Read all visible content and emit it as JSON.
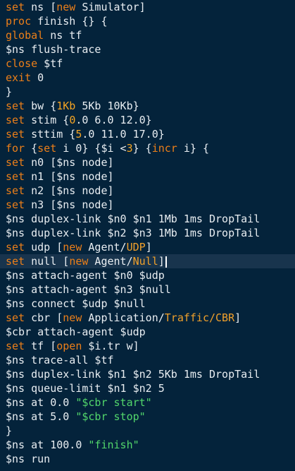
{
  "editor": {
    "lines": [
      [
        {
          "t": "set",
          "c": "kw"
        },
        {
          "t": " ns [",
          "c": "plain"
        },
        {
          "t": "new",
          "c": "kw"
        },
        {
          "t": " Simulator]",
          "c": "plain"
        }
      ],
      [
        {
          "t": "proc",
          "c": "kw"
        },
        {
          "t": " finish {} {",
          "c": "plain"
        }
      ],
      [
        {
          "t": "global",
          "c": "kw"
        },
        {
          "t": " ns tf",
          "c": "plain"
        }
      ],
      [
        {
          "t": "$ns flush-trace",
          "c": "plain"
        }
      ],
      [
        {
          "t": "close",
          "c": "kw"
        },
        {
          "t": " $tf",
          "c": "plain"
        }
      ],
      [
        {
          "t": "exit",
          "c": "kw"
        },
        {
          "t": " 0",
          "c": "plain"
        }
      ],
      [
        {
          "t": "}",
          "c": "plain"
        }
      ],
      [
        {
          "t": "set",
          "c": "kw"
        },
        {
          "t": " bw {",
          "c": "plain"
        },
        {
          "t": "1Kb",
          "c": "num"
        },
        {
          "t": " 5Kb 10Kb}",
          "c": "plain"
        }
      ],
      [
        {
          "t": "set",
          "c": "kw"
        },
        {
          "t": " stim {",
          "c": "plain"
        },
        {
          "t": "0",
          "c": "num"
        },
        {
          "t": ".0 6.0 12.0}",
          "c": "plain"
        }
      ],
      [
        {
          "t": "set",
          "c": "kw"
        },
        {
          "t": " sttim {",
          "c": "plain"
        },
        {
          "t": "5",
          "c": "num"
        },
        {
          "t": ".0 11.0 17.0}",
          "c": "plain"
        }
      ],
      [
        {
          "t": "for",
          "c": "kw"
        },
        {
          "t": " {",
          "c": "plain"
        },
        {
          "t": "set",
          "c": "kw"
        },
        {
          "t": " i 0} {$i <",
          "c": "plain"
        },
        {
          "t": "3",
          "c": "num"
        },
        {
          "t": "} {",
          "c": "plain"
        },
        {
          "t": "incr",
          "c": "kw"
        },
        {
          "t": " i} {",
          "c": "plain"
        }
      ],
      [
        {
          "t": "set",
          "c": "kw"
        },
        {
          "t": " n0 [$ns node]",
          "c": "plain"
        }
      ],
      [
        {
          "t": "set",
          "c": "kw"
        },
        {
          "t": " n1 [$ns node]",
          "c": "plain"
        }
      ],
      [
        {
          "t": "set",
          "c": "kw"
        },
        {
          "t": " n2 [$ns node]",
          "c": "plain"
        }
      ],
      [
        {
          "t": "set",
          "c": "kw"
        },
        {
          "t": " n3 [$ns node]",
          "c": "plain"
        }
      ],
      [
        {
          "t": "$ns duplex-link $n0 $n1 1Mb 1ms DropTail",
          "c": "plain"
        }
      ],
      [
        {
          "t": "$ns duplex-link $n2 $n3 1Mb 1ms DropTail",
          "c": "plain"
        }
      ],
      [
        {
          "t": "set",
          "c": "kw"
        },
        {
          "t": " udp [",
          "c": "plain"
        },
        {
          "t": "new",
          "c": "kw"
        },
        {
          "t": " Agent/",
          "c": "plain"
        },
        {
          "t": "UDP",
          "c": "fn"
        },
        {
          "t": "]",
          "c": "plain"
        }
      ],
      [
        {
          "t": "set",
          "c": "kw"
        },
        {
          "t": " null [",
          "c": "plain"
        },
        {
          "t": "new",
          "c": "kw"
        },
        {
          "t": " Agent/",
          "c": "plain"
        },
        {
          "t": "Null",
          "c": "fn"
        },
        {
          "t": "]",
          "c": "plain"
        }
      ],
      [
        {
          "t": "$ns attach-agent $n0 $udp",
          "c": "plain"
        }
      ],
      [
        {
          "t": "$ns attach-agent $n3 $null",
          "c": "plain"
        }
      ],
      [
        {
          "t": "$ns connect $udp $null",
          "c": "plain"
        }
      ],
      [
        {
          "t": "set",
          "c": "kw"
        },
        {
          "t": " cbr [",
          "c": "plain"
        },
        {
          "t": "new",
          "c": "kw"
        },
        {
          "t": " Application/",
          "c": "plain"
        },
        {
          "t": "Traffic/CBR",
          "c": "fn"
        },
        {
          "t": "]",
          "c": "plain"
        }
      ],
      [
        {
          "t": "$cbr attach-agent $udp",
          "c": "plain"
        }
      ],
      [
        {
          "t": "set",
          "c": "kw"
        },
        {
          "t": " tf [",
          "c": "plain"
        },
        {
          "t": "open",
          "c": "kw"
        },
        {
          "t": " $i.tr w]",
          "c": "plain"
        }
      ],
      [
        {
          "t": "$ns trace-all $tf",
          "c": "plain"
        }
      ],
      [
        {
          "t": "$ns duplex-link $n1 $n2 5Kb 1ms DropTail",
          "c": "plain"
        }
      ],
      [
        {
          "t": "$ns queue-limit $n1 $n2 5",
          "c": "plain"
        }
      ],
      [
        {
          "t": "$ns at 0.0 ",
          "c": "plain"
        },
        {
          "t": "\"$cbr start\"",
          "c": "str"
        }
      ],
      [
        {
          "t": "$ns at 5.0 ",
          "c": "plain"
        },
        {
          "t": "\"$cbr stop\"",
          "c": "str"
        }
      ],
      [
        {
          "t": "}",
          "c": "plain"
        }
      ],
      [
        {
          "t": "$ns at 100.0 ",
          "c": "plain"
        },
        {
          "t": "\"finish\"",
          "c": "str"
        }
      ],
      [
        {
          "t": "$ns run",
          "c": "plain"
        }
      ]
    ],
    "current_line": 18,
    "colors": {
      "background": "#04233b",
      "current_line": "#18344d",
      "keyword": "#ec7f19",
      "string": "#52d66b",
      "text": "#e9eef2"
    }
  }
}
